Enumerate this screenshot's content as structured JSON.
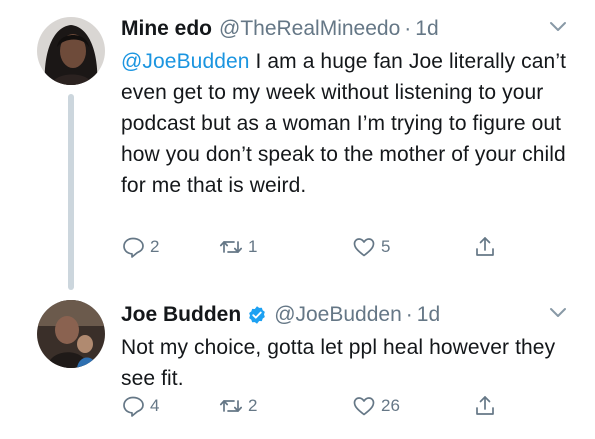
{
  "tweets": [
    {
      "display_name": "Mine edo",
      "handle": "@TheRealMineedo",
      "separator": "·",
      "time": "1d",
      "verified": false,
      "mention": "@JoeBudden",
      "text": " I am a huge fan Joe literally can’t even get to my week without listening to your podcast but as a woman I’m trying to figure out how you don’t speak to the mother of your child for me that is weird.",
      "replies": "2",
      "retweets": "1",
      "likes": "5"
    },
    {
      "display_name": "Joe Budden",
      "handle": "@JoeBudden",
      "separator": "·",
      "time": "1d",
      "verified": true,
      "text": "Not my choice, gotta let ppl heal however they see fit.",
      "replies": "4",
      "retweets": "2",
      "likes": "26"
    }
  ],
  "icons": {
    "reply": "reply-icon",
    "retweet": "retweet-icon",
    "like": "heart-icon",
    "share": "share-icon",
    "caret": "chevron-down-icon",
    "verified": "verified-badge-icon"
  },
  "colors": {
    "text": "#14171a",
    "secondary": "#657786",
    "link": "#1b95e0",
    "verified": "#1da1f2",
    "thread_line": "#ccd6dd"
  }
}
